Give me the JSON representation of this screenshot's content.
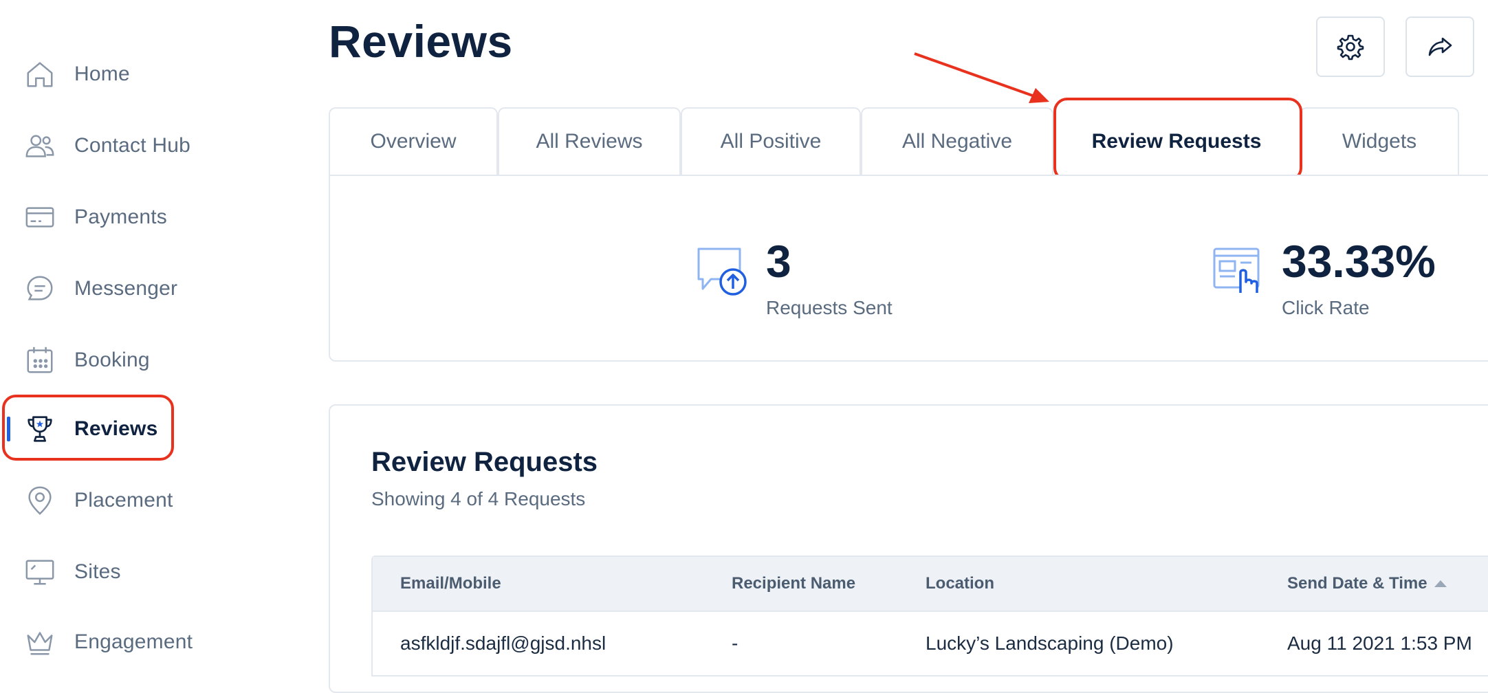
{
  "sidebar": {
    "items": [
      {
        "label": "Home",
        "icon": "home-icon"
      },
      {
        "label": "Contact Hub",
        "icon": "users-icon"
      },
      {
        "label": "Payments",
        "icon": "credit-card-icon"
      },
      {
        "label": "Messenger",
        "icon": "chat-icon"
      },
      {
        "label": "Booking",
        "icon": "calendar-icon"
      },
      {
        "label": "Reviews",
        "icon": "trophy-icon"
      },
      {
        "label": "Placement",
        "icon": "location-pin-icon"
      },
      {
        "label": "Sites",
        "icon": "monitor-icon"
      },
      {
        "label": "Engagement",
        "icon": "crown-icon"
      }
    ],
    "active": "Reviews"
  },
  "header": {
    "title": "Reviews",
    "buttons": [
      {
        "icon": "gear-icon"
      },
      {
        "icon": "share-icon"
      }
    ]
  },
  "tabs": [
    {
      "label": "Overview"
    },
    {
      "label": "All Reviews"
    },
    {
      "label": "All Positive"
    },
    {
      "label": "All Negative"
    },
    {
      "label": "Review Requests"
    },
    {
      "label": "Widgets"
    }
  ],
  "active_tab": "Review Requests",
  "stats": [
    {
      "value": "3",
      "label": "Requests Sent",
      "icon": "message-upload-icon"
    },
    {
      "value": "33.33%",
      "label": "Click Rate",
      "icon": "click-rate-icon"
    }
  ],
  "requests": {
    "title": "Review Requests",
    "subtitle": "Showing 4 of 4 Requests",
    "columns": [
      "Email/Mobile",
      "Recipient Name",
      "Location",
      "Send Date & Time"
    ],
    "rows": [
      [
        "asfkldjf.sdajfl@gjsd.nhsl",
        "-",
        "Lucky’s Landscaping (Demo)",
        "Aug 11 2021 1:53 PM"
      ]
    ]
  },
  "colors": {
    "accent": "#1f5fe0",
    "annotation": "#e8321e",
    "text_dark": "#0f2340",
    "text_muted": "#5a6b80"
  }
}
